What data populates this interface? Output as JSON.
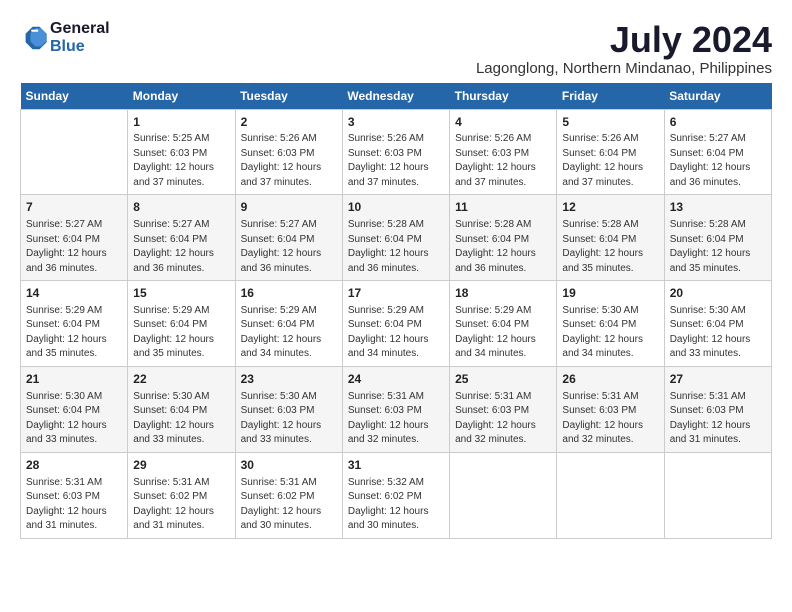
{
  "header": {
    "logo_line1": "General",
    "logo_line2": "Blue",
    "month_year": "July 2024",
    "location": "Lagonglong, Northern Mindanao, Philippines"
  },
  "weekdays": [
    "Sunday",
    "Monday",
    "Tuesday",
    "Wednesday",
    "Thursday",
    "Friday",
    "Saturday"
  ],
  "weeks": [
    [
      {
        "day": "",
        "info": ""
      },
      {
        "day": "1",
        "info": "Sunrise: 5:25 AM\nSunset: 6:03 PM\nDaylight: 12 hours\nand 37 minutes."
      },
      {
        "day": "2",
        "info": "Sunrise: 5:26 AM\nSunset: 6:03 PM\nDaylight: 12 hours\nand 37 minutes."
      },
      {
        "day": "3",
        "info": "Sunrise: 5:26 AM\nSunset: 6:03 PM\nDaylight: 12 hours\nand 37 minutes."
      },
      {
        "day": "4",
        "info": "Sunrise: 5:26 AM\nSunset: 6:03 PM\nDaylight: 12 hours\nand 37 minutes."
      },
      {
        "day": "5",
        "info": "Sunrise: 5:26 AM\nSunset: 6:04 PM\nDaylight: 12 hours\nand 37 minutes."
      },
      {
        "day": "6",
        "info": "Sunrise: 5:27 AM\nSunset: 6:04 PM\nDaylight: 12 hours\nand 36 minutes."
      }
    ],
    [
      {
        "day": "7",
        "info": "Sunrise: 5:27 AM\nSunset: 6:04 PM\nDaylight: 12 hours\nand 36 minutes."
      },
      {
        "day": "8",
        "info": "Sunrise: 5:27 AM\nSunset: 6:04 PM\nDaylight: 12 hours\nand 36 minutes."
      },
      {
        "day": "9",
        "info": "Sunrise: 5:27 AM\nSunset: 6:04 PM\nDaylight: 12 hours\nand 36 minutes."
      },
      {
        "day": "10",
        "info": "Sunrise: 5:28 AM\nSunset: 6:04 PM\nDaylight: 12 hours\nand 36 minutes."
      },
      {
        "day": "11",
        "info": "Sunrise: 5:28 AM\nSunset: 6:04 PM\nDaylight: 12 hours\nand 36 minutes."
      },
      {
        "day": "12",
        "info": "Sunrise: 5:28 AM\nSunset: 6:04 PM\nDaylight: 12 hours\nand 35 minutes."
      },
      {
        "day": "13",
        "info": "Sunrise: 5:28 AM\nSunset: 6:04 PM\nDaylight: 12 hours\nand 35 minutes."
      }
    ],
    [
      {
        "day": "14",
        "info": "Sunrise: 5:29 AM\nSunset: 6:04 PM\nDaylight: 12 hours\nand 35 minutes."
      },
      {
        "day": "15",
        "info": "Sunrise: 5:29 AM\nSunset: 6:04 PM\nDaylight: 12 hours\nand 35 minutes."
      },
      {
        "day": "16",
        "info": "Sunrise: 5:29 AM\nSunset: 6:04 PM\nDaylight: 12 hours\nand 34 minutes."
      },
      {
        "day": "17",
        "info": "Sunrise: 5:29 AM\nSunset: 6:04 PM\nDaylight: 12 hours\nand 34 minutes."
      },
      {
        "day": "18",
        "info": "Sunrise: 5:29 AM\nSunset: 6:04 PM\nDaylight: 12 hours\nand 34 minutes."
      },
      {
        "day": "19",
        "info": "Sunrise: 5:30 AM\nSunset: 6:04 PM\nDaylight: 12 hours\nand 34 minutes."
      },
      {
        "day": "20",
        "info": "Sunrise: 5:30 AM\nSunset: 6:04 PM\nDaylight: 12 hours\nand 33 minutes."
      }
    ],
    [
      {
        "day": "21",
        "info": "Sunrise: 5:30 AM\nSunset: 6:04 PM\nDaylight: 12 hours\nand 33 minutes."
      },
      {
        "day": "22",
        "info": "Sunrise: 5:30 AM\nSunset: 6:04 PM\nDaylight: 12 hours\nand 33 minutes."
      },
      {
        "day": "23",
        "info": "Sunrise: 5:30 AM\nSunset: 6:03 PM\nDaylight: 12 hours\nand 33 minutes."
      },
      {
        "day": "24",
        "info": "Sunrise: 5:31 AM\nSunset: 6:03 PM\nDaylight: 12 hours\nand 32 minutes."
      },
      {
        "day": "25",
        "info": "Sunrise: 5:31 AM\nSunset: 6:03 PM\nDaylight: 12 hours\nand 32 minutes."
      },
      {
        "day": "26",
        "info": "Sunrise: 5:31 AM\nSunset: 6:03 PM\nDaylight: 12 hours\nand 32 minutes."
      },
      {
        "day": "27",
        "info": "Sunrise: 5:31 AM\nSunset: 6:03 PM\nDaylight: 12 hours\nand 31 minutes."
      }
    ],
    [
      {
        "day": "28",
        "info": "Sunrise: 5:31 AM\nSunset: 6:03 PM\nDaylight: 12 hours\nand 31 minutes."
      },
      {
        "day": "29",
        "info": "Sunrise: 5:31 AM\nSunset: 6:02 PM\nDaylight: 12 hours\nand 31 minutes."
      },
      {
        "day": "30",
        "info": "Sunrise: 5:31 AM\nSunset: 6:02 PM\nDaylight: 12 hours\nand 30 minutes."
      },
      {
        "day": "31",
        "info": "Sunrise: 5:32 AM\nSunset: 6:02 PM\nDaylight: 12 hours\nand 30 minutes."
      },
      {
        "day": "",
        "info": ""
      },
      {
        "day": "",
        "info": ""
      },
      {
        "day": "",
        "info": ""
      }
    ]
  ]
}
